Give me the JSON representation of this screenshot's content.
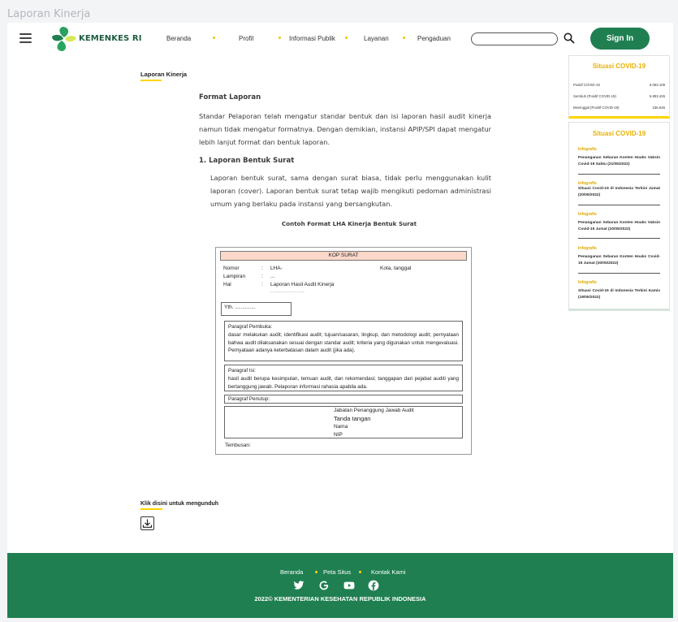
{
  "browser": {
    "title": "Laporan Kinerja"
  },
  "header": {
    "logo_text": "KEMENKES RI",
    "nav": [
      "Beranda",
      "Profil",
      "Informasi Publik",
      "Layanan",
      "Pengaduan"
    ],
    "search_placeholder": "",
    "sign_in": "Sign In"
  },
  "main": {
    "title": "Laporan Kinerja",
    "document": {
      "heading": "Format Laporan",
      "intro": "Standar Pelaporan telah mengatur standar bentuk dan isi laporan hasil audit kinerja namun tidak mengatur formatnya. Dengan demikian, instansi APIP/SPI dapat mengatur lebih lanjut format dan bentuk laporan.",
      "subheading": "1.  Laporan Bentuk Surat",
      "body": "Laporan bentuk surat, sama dengan surat biasa, tidak perlu menggunakan kulit laporan (cover). Laporan bentuk surat tetap wajib mengikuti pedoman administrasi umum yang berlaku pada instansi yang bersangkutan.",
      "caption": "Contoh Format LHA Kinerja Bentuk Surat",
      "form": {
        "kop": "KOP SURAT",
        "nomor_label": "Nomor",
        "nomor_value": "LHA-",
        "city_date": "Kota, tanggal",
        "lampiran_label": "Lampiran",
        "lampiran_value": "...",
        "hal_label": "Hal",
        "hal_value": "Laporan Hasil Audit Kinerja",
        "hal_dots": "......................................",
        "yth": "Yth. ..............",
        "pembuka_title": "Paragraf Pembuka:",
        "pembuka_body": "dasar melakukan audit; identifikasi audit; tujuan/sasaran, lingkup, dan metodologi audit; pernyataan bahwa audit dilaksanakan sesuai dengan standar audit; kriteria yang digunakan untuk mengevaluasi. Pernyataan adanya keterbatasan dalam audit (jika ada).",
        "isi_title": "Paragraf Isi:",
        "isi_body": "hasil audit berupa kesimpulan, temuan audit, dan rekomendasi; tanggapan dari pejabat auditi yang bertanggung jawab. Pelaporan informasi rahasia apabila ada.",
        "penutup_title": "Paragraf Penutup:",
        "jabatan": "Jabatan Penanggung Jawab Audit",
        "tanda_tangan": "Tanda tangan",
        "nama": "Nama",
        "nip": "NIP",
        "tembusan": "Tembusan:"
      }
    },
    "download_label": "Klik disini untuk mengunduh"
  },
  "sidebar": {
    "covid_title": "Situasi COVID-19",
    "stats": [
      {
        "label": "Positif COVID-19",
        "value": "6.053.109"
      },
      {
        "label": "Sembuh (Positif COVID-19)",
        "value": "5.893.426"
      },
      {
        "label": "Meninggal (Positif COVID-19)",
        "value": "156.546"
      }
    ],
    "news_title": "Situasi COVID-19",
    "news": [
      {
        "tag": "Infografis",
        "text": "Penanganan Sebaran Konten Hoaks Vaksin Covid-19 Sabtu (21/05/2022)"
      },
      {
        "tag": "Infografis",
        "text": "Situasi Covid-19 di Indonesia Terkini Jumat (20/05/2022)"
      },
      {
        "tag": "Infografis",
        "text": "Penanganan Sebaran Konten Hoaks Vaksin Covid-19 Jumat (20/05/2022)"
      },
      {
        "tag": "Infografis",
        "text": "Penanganan Sebaran Konten Hoaks Covid-19 Jumat (20/05/2022)"
      },
      {
        "tag": "Infografis",
        "text": "Situasi Covid-19 di Indonesia Terkini Kamis (19/05/2022)"
      }
    ]
  },
  "footer": {
    "links": [
      "Beranda",
      "Peta Situs",
      "Kontak Kami"
    ],
    "icons": [
      "twitter-icon",
      "google-icon",
      "youtube-icon",
      "facebook-icon"
    ],
    "copyright": "2022© KEMENTERIAN KESEHATAN REPUBLIK INDONESIA"
  },
  "colors": {
    "brand_green": "#1f7f51",
    "accent_yellow": "#ffd400",
    "covid_orange": "#e8b100"
  }
}
